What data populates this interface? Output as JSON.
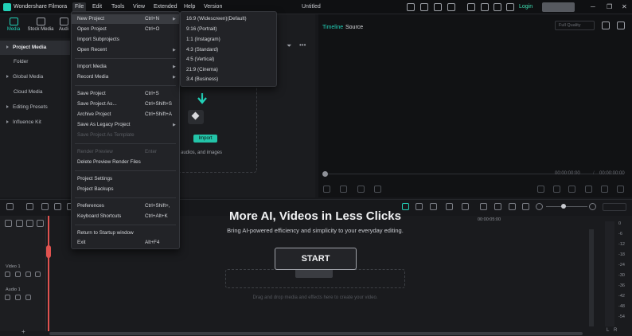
{
  "app": {
    "name": "Wondershare Filmora",
    "document_title": "Untitled",
    "login": "Login"
  },
  "menubar": [
    "File",
    "Edit",
    "Tools",
    "View",
    "Extended",
    "Help",
    "Version"
  ],
  "tabs": [
    {
      "label": "Media",
      "icon": "media-icon"
    },
    {
      "label": "Stock Media",
      "icon": "stock-media-icon"
    },
    {
      "label": "Audi",
      "icon": "audio-icon"
    }
  ],
  "sidebar": [
    {
      "label": "Project Media"
    },
    {
      "label": "Folder"
    },
    {
      "label": "Global Media"
    },
    {
      "label": "Cloud Media"
    },
    {
      "label": "Editing Presets"
    },
    {
      "label": "Influence Kit"
    }
  ],
  "media": {
    "import_label": "Import",
    "hint": "audios, and images"
  },
  "preview": {
    "tab_timeline": "Timeline",
    "tab_source": "Source",
    "quality": "Full Quality",
    "time_current": "00:00:00:00",
    "time_total": "00:00:00:00"
  },
  "file_menu": [
    {
      "label": "New Project",
      "shortcut": "Ctrl+N",
      "arrow": true,
      "hover": true
    },
    {
      "label": "Open Project",
      "shortcut": "Ctrl+O"
    },
    {
      "label": "Import Subprojects",
      "shortcut": ""
    },
    {
      "label": "Open Recent",
      "shortcut": "",
      "arrow": true
    },
    {
      "label": "Import Media",
      "shortcut": "",
      "arrow": true
    },
    {
      "label": "Record Media",
      "shortcut": "",
      "arrow": true
    },
    {
      "label": "Save Project",
      "shortcut": "Ctrl+S"
    },
    {
      "label": "Save Project As...",
      "shortcut": "Ctrl+Shift+S"
    },
    {
      "label": "Archive Project",
      "shortcut": "Ctrl+Shift+A"
    },
    {
      "label": "Save As Legacy Project",
      "shortcut": "",
      "arrow": true
    },
    {
      "label": "Save Project As Template",
      "shortcut": "",
      "disabled": true
    },
    {
      "label": "Render Preview",
      "shortcut": "Enter",
      "disabled": true
    },
    {
      "label": "Delete Preview Render Files",
      "shortcut": ""
    },
    {
      "label": "Project Settings",
      "shortcut": ""
    },
    {
      "label": "Project Backups",
      "shortcut": ""
    },
    {
      "label": "Preferences",
      "shortcut": "Ctrl+Shift+,"
    },
    {
      "label": "Keyboard Shortcuts",
      "shortcut": "Ctrl+Alt+K"
    },
    {
      "label": "Return to Startup window",
      "shortcut": ""
    },
    {
      "label": "Exit",
      "shortcut": "Alt+F4"
    }
  ],
  "new_project_submenu": [
    "16:9 (Widescreen)(Default)",
    "9:16 (Portrait)",
    "1:1 (Instagram)",
    "4:3 (Standard)",
    "4:5 (Vertical)",
    "21:9 (Cinema)",
    "3:4 (Business)"
  ],
  "promo": {
    "title": "More AI, Videos in Less Clicks",
    "subtitle": "Bring AI-powered efficiency and simplicity to your everyday editing.",
    "start": "START",
    "drop_hint": "Drag and drop media and effects here to create your video."
  },
  "timeline": {
    "track_video": "Video 1",
    "track_audio": "Audio 1",
    "ruler_mark": "00:00:05:00",
    "meter_ticks": [
      "0",
      "-6",
      "-12",
      "-18",
      "-24",
      "-30",
      "-36",
      "-42",
      "-48",
      "-54"
    ],
    "meter_l": "L",
    "meter_r": "R"
  }
}
